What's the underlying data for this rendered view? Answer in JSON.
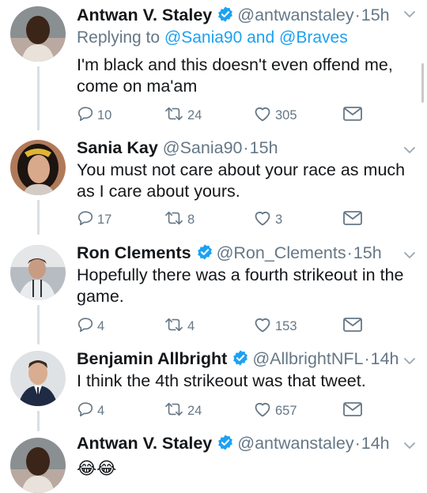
{
  "colors": {
    "text": "#14171a",
    "secondary": "#657786",
    "link": "#1da1f2",
    "verified": "#1da1f2",
    "thread_line": "#d8dfe4"
  },
  "icons": {
    "reply": "reply-icon",
    "retweet": "retweet-icon",
    "like": "heart-icon",
    "dm": "envelope-icon",
    "more": "chevron-down-icon",
    "verified": "verified-badge-icon"
  },
  "tweets": [
    {
      "name": "Antwan V. Staley",
      "verified": true,
      "handle": "@antwanstaley",
      "time": "15h",
      "reply_prefix": "Replying to ",
      "reply_user1": "@Sania90",
      "reply_and": " and ",
      "reply_user2": "@Braves",
      "text": "I'm black and this doesn't even offend me, come on ma'am",
      "replies": "10",
      "retweets": "24",
      "likes": "305"
    },
    {
      "name": "Sania Kay",
      "verified": false,
      "handle": "@Sania90",
      "time": "15h",
      "text": "You must not care about your race as much as I care about yours.",
      "replies": "17",
      "retweets": "8",
      "likes": "3"
    },
    {
      "name": "Ron Clements",
      "verified": true,
      "handle": "@Ron_Clements",
      "time": "15h",
      "text": "Hopefully there was a fourth strikeout in the game.",
      "replies": "4",
      "retweets": "4",
      "likes": "153"
    },
    {
      "name": "Benjamin Allbright",
      "verified": true,
      "handle": "@AllbrightNFL",
      "time": "14h",
      "text": "I think the 4th strikeout was that tweet.",
      "replies": "4",
      "retweets": "24",
      "likes": "657"
    },
    {
      "name": "Antwan V. Staley",
      "verified": true,
      "handle": "@antwanstaley",
      "time": "14h",
      "text": "😂😂"
    }
  ]
}
